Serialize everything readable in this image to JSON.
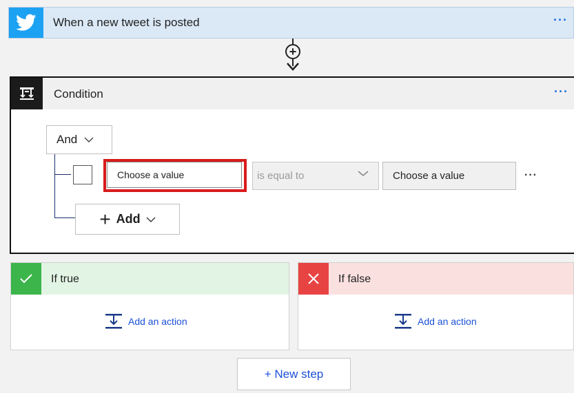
{
  "trigger": {
    "title": "When a new tweet is posted",
    "menu": "···",
    "icon": "twitter-bird-icon",
    "color": "#1da1f2"
  },
  "connector": {
    "icon": "plus-circle-icon",
    "symbol": "+"
  },
  "condition": {
    "title": "Condition",
    "menu": "···",
    "icon": "condition-icon",
    "group_operator": "And",
    "row": {
      "left_value_placeholder": "Choose a value",
      "operator": "is equal to",
      "right_value_placeholder": "Choose a value",
      "menu": "···"
    },
    "add_label": "Add",
    "add_symbol": "+",
    "highlight_color": "#d81b1b"
  },
  "branches": {
    "true": {
      "title": "If true",
      "add_action": "Add an action",
      "color": "#3cb54a"
    },
    "false": {
      "title": "If false",
      "add_action": "Add an action",
      "color": "#e84343"
    }
  },
  "new_step": {
    "label": "+ New step"
  }
}
